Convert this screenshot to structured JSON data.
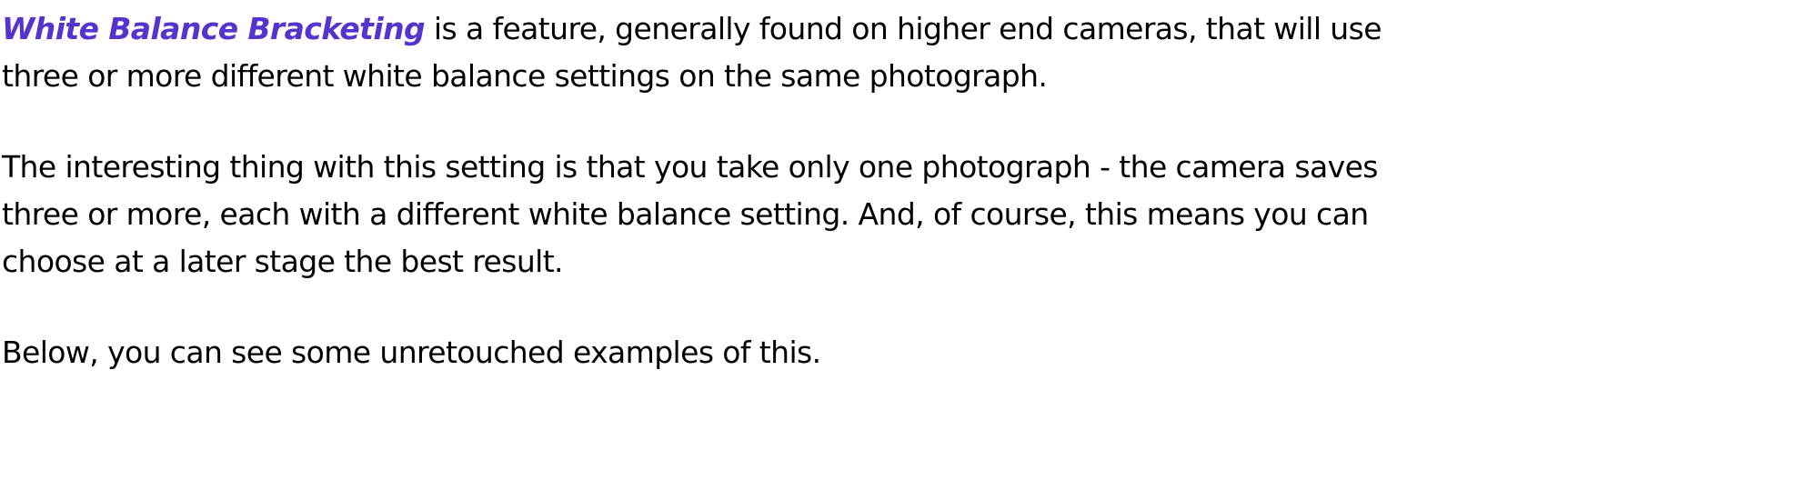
{
  "paragraphs": [
    {
      "term": "White Balance Bracketing",
      "lines": [
        " is a feature, generally found on higher end cameras, that will use",
        "three or more different white balance settings on the same photograph."
      ]
    },
    {
      "lines": [
        "The interesting thing with this setting is that you take only one photograph - the camera saves",
        "three or more, each with a different white balance setting. And, of course, this means you can",
        "choose at a later stage the best result."
      ]
    },
    {
      "lines": [
        "Below, you can see some unretouched examples of this."
      ]
    }
  ],
  "colors": {
    "term": "#5533cc",
    "text": "#000000"
  }
}
